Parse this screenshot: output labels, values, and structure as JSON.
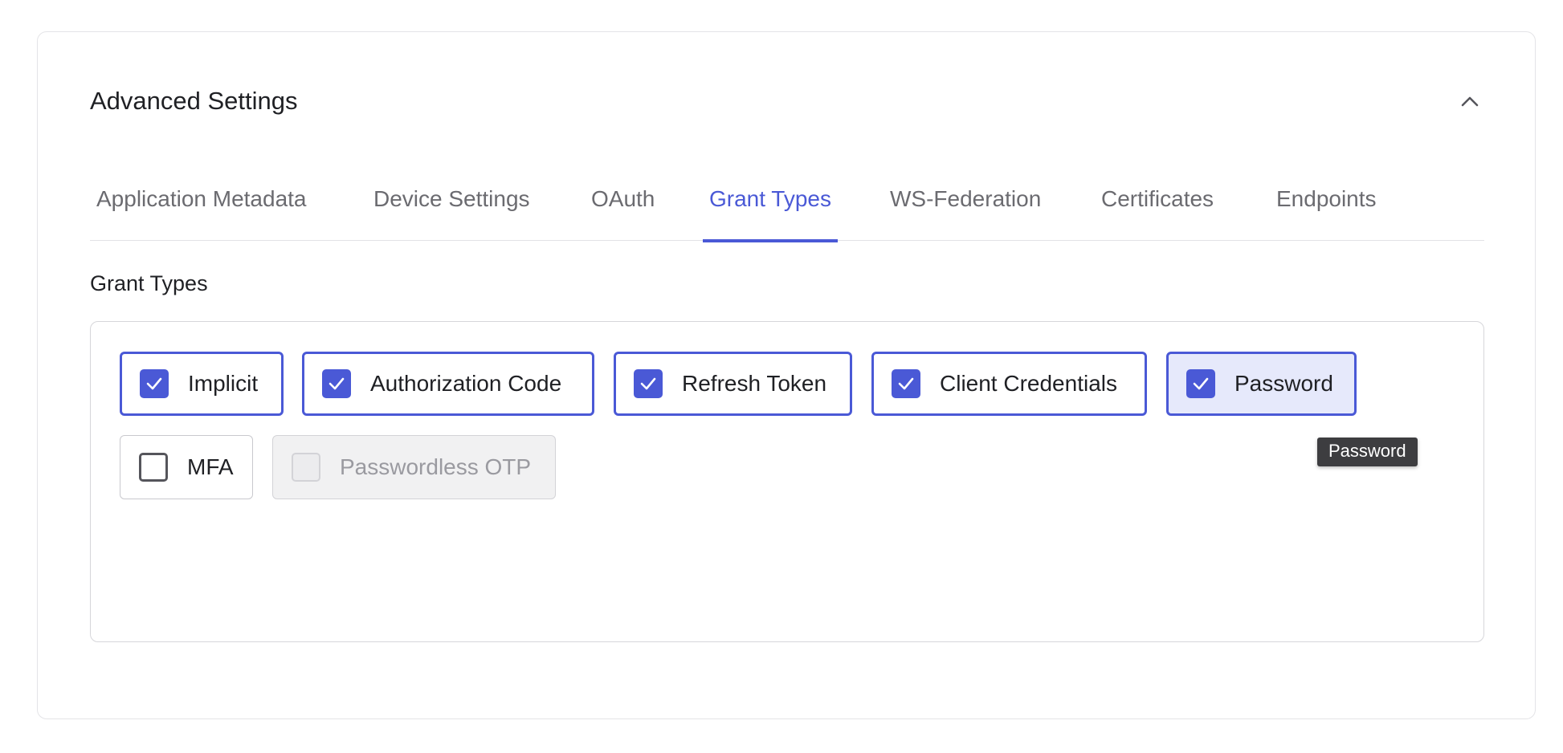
{
  "card": {
    "title": "Advanced Settings",
    "collapse_icon": "chevron-up-icon"
  },
  "tabs": [
    {
      "label": "Application Metadata",
      "active": false
    },
    {
      "label": "Device Settings",
      "active": false
    },
    {
      "label": "OAuth",
      "active": false
    },
    {
      "label": "Grant Types",
      "active": true
    },
    {
      "label": "WS-Federation",
      "active": false
    },
    {
      "label": "Certificates",
      "active": false
    },
    {
      "label": "Endpoints",
      "active": false
    }
  ],
  "section": {
    "title": "Grant Types"
  },
  "grant_types": [
    {
      "label": "Implicit",
      "checked": true,
      "disabled": false
    },
    {
      "label": "Authorization Code",
      "checked": true,
      "disabled": false
    },
    {
      "label": "Refresh Token",
      "checked": true,
      "disabled": false
    },
    {
      "label": "Client Credentials",
      "checked": true,
      "disabled": false
    },
    {
      "label": "Password",
      "checked": true,
      "disabled": false,
      "hovered": true
    },
    {
      "label": "MFA",
      "checked": false,
      "disabled": false
    },
    {
      "label": "Passwordless OTP",
      "checked": false,
      "disabled": true
    }
  ],
  "tooltip": {
    "text": "Password"
  },
  "colors": {
    "accent": "#4a59d6",
    "hover_bg": "#e6e9fb",
    "tooltip_bg": "#3d3d40"
  }
}
